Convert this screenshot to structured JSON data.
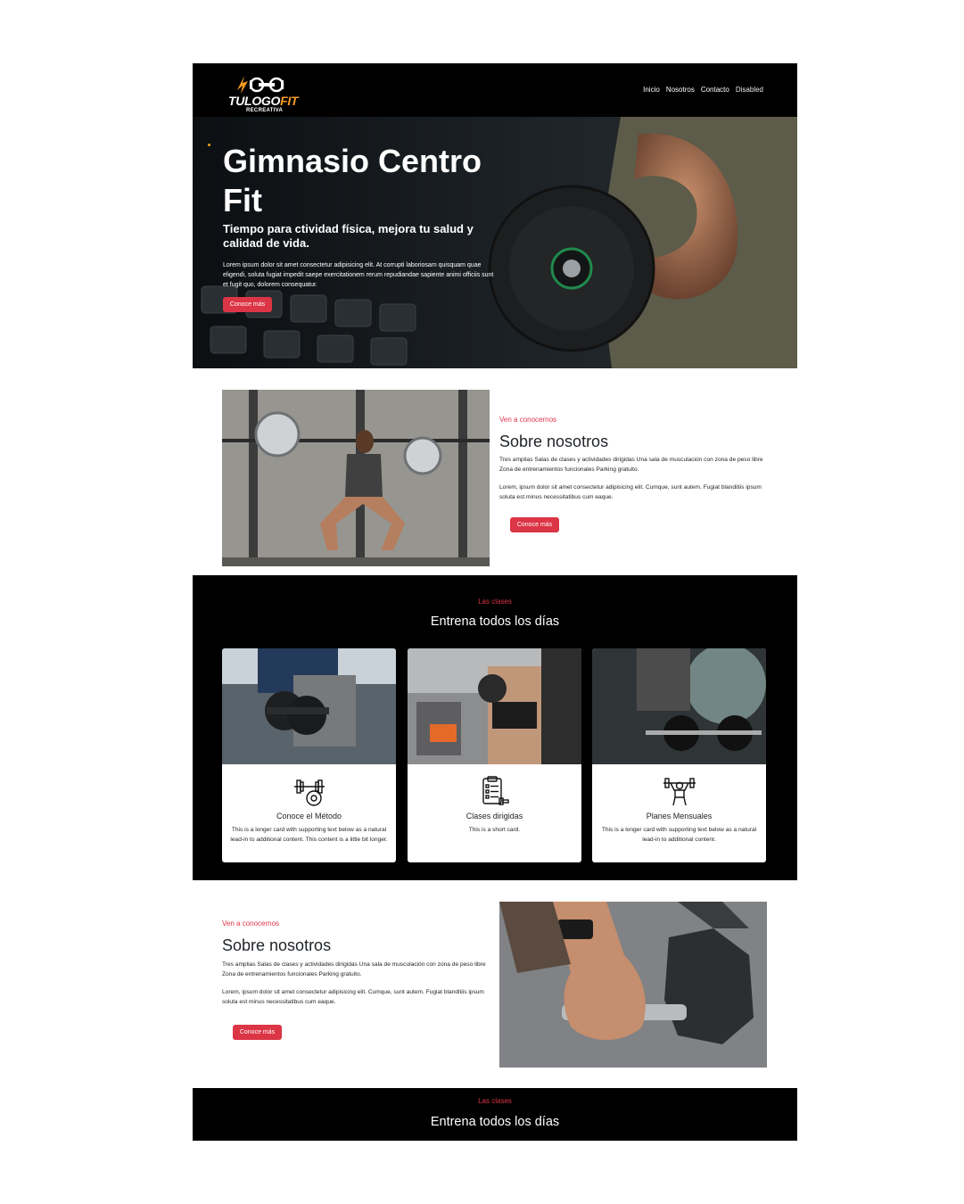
{
  "navbar": {
    "logo": {
      "brand_main": "TULOGO",
      "brand_accent": "FIT",
      "subtitle": "RECREATIVA"
    },
    "links": [
      {
        "label": "Inicio"
      },
      {
        "label": "Nosotros"
      },
      {
        "label": "Contacto"
      },
      {
        "label": "Disabled"
      }
    ]
  },
  "hero": {
    "title": "Gimnasio Centro Fit",
    "subtitle": "Tiempo para ctividad física, mejora tu salud y calidad de vida.",
    "text": "Lorem ipsum dolor sit amet consectetur adipisicing elit. At corrupti laboriosam quisquam quae eligendi, soluta fugiat impedit saepe exercitationem rerum repudiandae sapiente animi officiis sunt et fugit quo, dolorem consequatur.",
    "button": "Conoce más"
  },
  "about": {
    "kicker": "Ven a conocernos",
    "title": "Sobre nosotros",
    "text1": "Tres amplias Salas de clases y actividades dirigidas Una sala de musculación con zona de peso libre Zona de entrenamientos funcionales Parking gratuito.",
    "text2": "Lorem, ipsum dolor sit amet consectetur adipisicing elit. Cumque, sunt autem. Fugiat blanditiis ipsum soluta est minus necessitatibus cum eaque.",
    "button": "Conoce más"
  },
  "classes": {
    "kicker": "Las clases",
    "title": "Entrena todos los días",
    "cards": [
      {
        "icon": "barbell-plate-icon",
        "title": "Conoce el Método",
        "text": "This is a longer card with supporting text below as a natural lead-in to additional content. This content is a little bit longer."
      },
      {
        "icon": "clipboard-checklist-icon",
        "title": "Clases dirigidas",
        "text": "This is a short card."
      },
      {
        "icon": "weightlifter-icon",
        "title": "Planes Mensuales",
        "text": "This is a longer card with supporting text below as a natural lead-in to additional content."
      }
    ]
  },
  "about2": {
    "kicker": "Ven a conocernos",
    "title": "Sobre nosotros",
    "text1": "Tres amplias Salas de clases y actividades dirigidas Una sala de musculación con zona de peso libre Zona de entrenamientos funcionales Parking gratuito.",
    "text2": "Lorem, ipsum dolor sit amet consectetur adipisicing elit. Cumque, sunt autem. Fugiat blanditiis ipsum soluta est minus necessitatibus cum eaque.",
    "button": "Conoce más"
  },
  "classes2": {
    "kicker": "Las clases",
    "title": "Entrena todos los días"
  },
  "colors": {
    "accent": "#dc3545",
    "brand_orange": "#f39c1f",
    "dark": "#000000"
  }
}
